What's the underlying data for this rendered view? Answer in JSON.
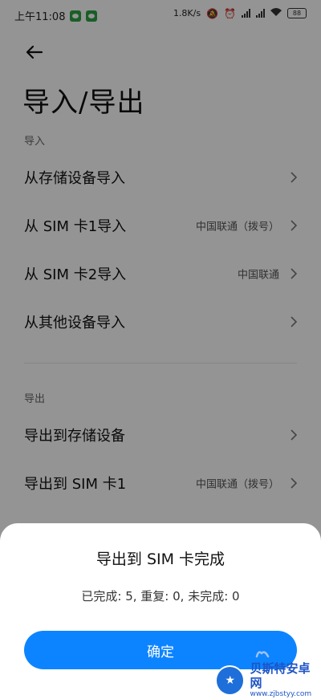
{
  "status_bar": {
    "time": "上午11:08",
    "speed": "1.8K/s",
    "battery": "88"
  },
  "header": {
    "title": "导入/导出"
  },
  "import_section": {
    "label": "导入",
    "items": [
      {
        "label": "从存储设备导入",
        "sub": ""
      },
      {
        "label": "从 SIM 卡1导入",
        "sub": "中国联通（拨号）"
      },
      {
        "label": "从 SIM 卡2导入",
        "sub": "中国联通"
      },
      {
        "label": "从其他设备导入",
        "sub": ""
      }
    ]
  },
  "export_section": {
    "label": "导出",
    "items": [
      {
        "label": "导出到存储设备",
        "sub": ""
      },
      {
        "label": "导出到 SIM 卡1",
        "sub": "中国联通（拨号）"
      }
    ]
  },
  "dialog": {
    "title": "导出到 SIM 卡完成",
    "message": "已完成: 5, 重复: 0, 未完成: 0",
    "confirm_label": "确定"
  },
  "watermark": {
    "name": "贝斯特安卓网",
    "url": "www.zjbstyy.com"
  },
  "colors": {
    "accent": "#0d84ff",
    "overlay": "#000000"
  }
}
